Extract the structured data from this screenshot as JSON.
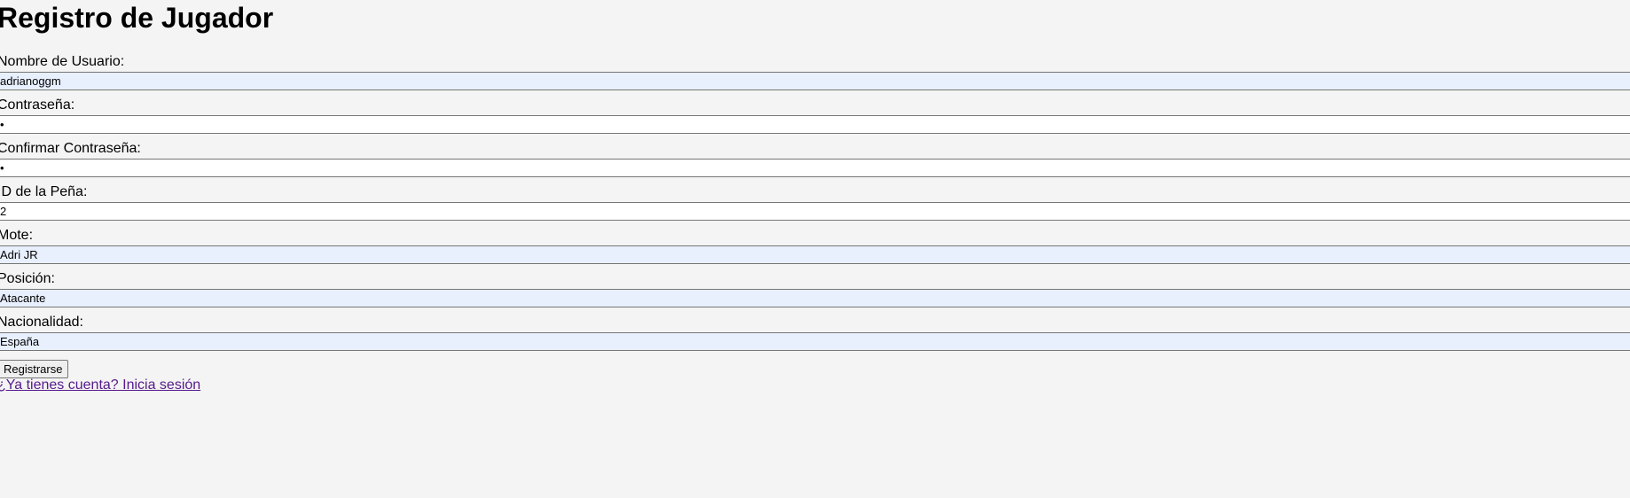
{
  "title": "Registro de Jugador",
  "fields": [
    {
      "label": "Nombre de Usuario:",
      "value": "adrianoggm",
      "autofilled": true
    },
    {
      "label": "Contraseña:",
      "value": "•",
      "autofilled": false
    },
    {
      "label": "Confirmar Contraseña:",
      "value": "•",
      "autofilled": false
    },
    {
      "label": "ID de la Peña:",
      "value": "2",
      "autofilled": false
    },
    {
      "label": "Mote:",
      "value": "Adri JR",
      "autofilled": true
    },
    {
      "label": "Posición:",
      "value": "Atacante",
      "autofilled": true
    },
    {
      "label": "Nacionalidad:",
      "value": "España",
      "autofilled": true
    }
  ],
  "submit_label": "Registrarse",
  "login_link": "¿Ya tienes cuenta? Inicia sesión",
  "colors": {
    "autofill_bg": "#e8f0fe",
    "page_bg": "#f4f4f4",
    "link": "#551a8b"
  }
}
